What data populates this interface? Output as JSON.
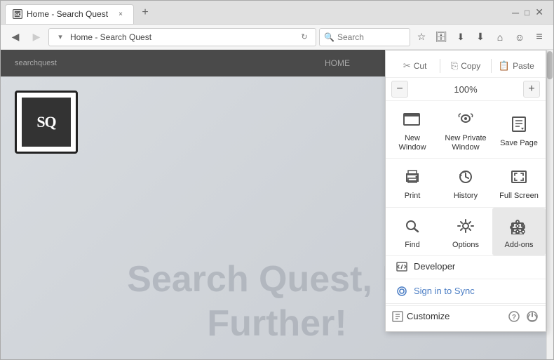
{
  "window": {
    "title": "Home - Search Quest"
  },
  "tab": {
    "label": "Home - Search Quest",
    "favicon": "SQ",
    "close": "×",
    "new_tab": "+"
  },
  "nav": {
    "back": "←",
    "forward": "→",
    "address": "Home - Search Quest",
    "search_placeholder": "Search",
    "refresh": "↻",
    "dropdown": "▾"
  },
  "site": {
    "tagline_line1": "Search Quest, Lo",
    "tagline_line2": "Further!",
    "home_label": "HOME",
    "logo_text": "SQ"
  },
  "menu": {
    "cut_label": "Cut",
    "copy_label": "Copy",
    "paste_label": "Paste",
    "zoom_value": "100%",
    "zoom_minus": "−",
    "zoom_plus": "+",
    "new_window_label": "New Window",
    "new_private_label": "New Private\nWindow",
    "save_page_label": "Save Page",
    "print_label": "Print",
    "history_label": "History",
    "full_screen_label": "Full Screen",
    "find_label": "Find",
    "options_label": "Options",
    "addons_label": "Add-ons",
    "developer_label": "Developer",
    "sign_in_label": "Sign in to Sync",
    "customize_label": "Customize",
    "help_icon": "?",
    "power_icon": "⏻"
  }
}
